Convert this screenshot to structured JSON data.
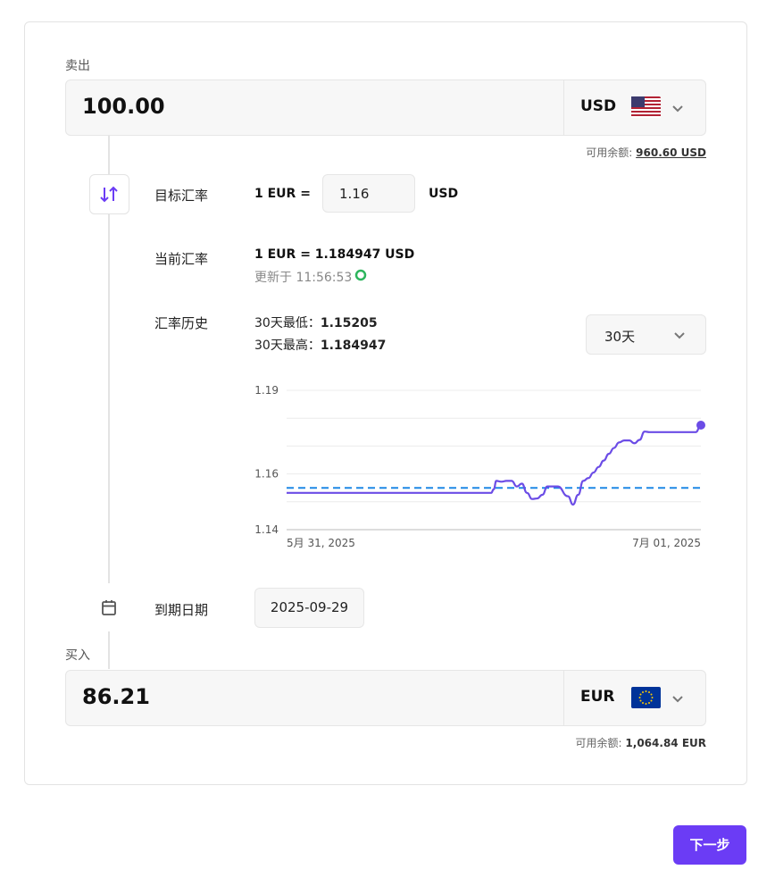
{
  "sell": {
    "label": "卖出",
    "amount": "100.00",
    "currency": "USD",
    "flag_icon": "us-flag-icon",
    "balance_label": "可用余额:",
    "balance_value": "960.60 USD"
  },
  "target_rate": {
    "label": "目标汇率",
    "prefix": "1 EUR =",
    "value": "1.16",
    "suffix": "USD"
  },
  "current_rate": {
    "label": "当前汇率",
    "value": "1 EUR = 1.184947 USD",
    "updated": "更新于 11:56:53"
  },
  "history": {
    "label": "汇率历史",
    "low_label": "30天最低：",
    "low_value": "1.15205",
    "high_label": "30天最高：",
    "high_value": "1.184947",
    "period": "30天"
  },
  "chart_data": {
    "type": "line",
    "x_start_label": "5月 31, 2025",
    "x_end_label": "7月 01, 2025",
    "ylim": [
      1.14,
      1.19
    ],
    "yticks": [
      "1.19",
      "1.16",
      "1.14"
    ],
    "target_line": 1.155,
    "series": [
      {
        "x": [
          0,
          40,
          40.5,
          41,
          42,
          43,
          44,
          45,
          46,
          47,
          48,
          49,
          50,
          51,
          52,
          53,
          55,
          56,
          57,
          58,
          59,
          60,
          61,
          62,
          63,
          64,
          65,
          66,
          67,
          68,
          69,
          70,
          71,
          72,
          73,
          75,
          77,
          78,
          79,
          80,
          81
        ],
        "y": [
          1.1532,
          1.1532,
          1.1545,
          1.1575,
          1.1572,
          1.1575,
          1.1575,
          1.1555,
          1.1565,
          1.1532,
          1.151,
          1.1512,
          1.1525,
          1.1555,
          1.1555,
          1.1555,
          1.152,
          1.149,
          1.1525,
          1.1575,
          1.1585,
          1.1605,
          1.1625,
          1.1648,
          1.1672,
          1.1693,
          1.1713,
          1.172,
          1.172,
          1.171,
          1.1722,
          1.1752,
          1.175,
          1.175,
          1.175,
          1.175,
          1.175,
          1.175,
          1.175,
          1.175,
          1.1775
        ]
      }
    ]
  },
  "expiry": {
    "label": "到期日期",
    "date": "2025-09-29"
  },
  "buy": {
    "label": "买入",
    "amount": "86.21",
    "currency": "EUR",
    "flag_icon": "eu-flag-icon",
    "balance_label": "可用余额:",
    "balance_value": "1,064.84 EUR"
  },
  "next_button": "下一步",
  "colors": {
    "accent": "#6b3cf5",
    "line": "#6b4ce6",
    "target_line": "#1e88e5",
    "updated_dot": "#2db55d"
  }
}
